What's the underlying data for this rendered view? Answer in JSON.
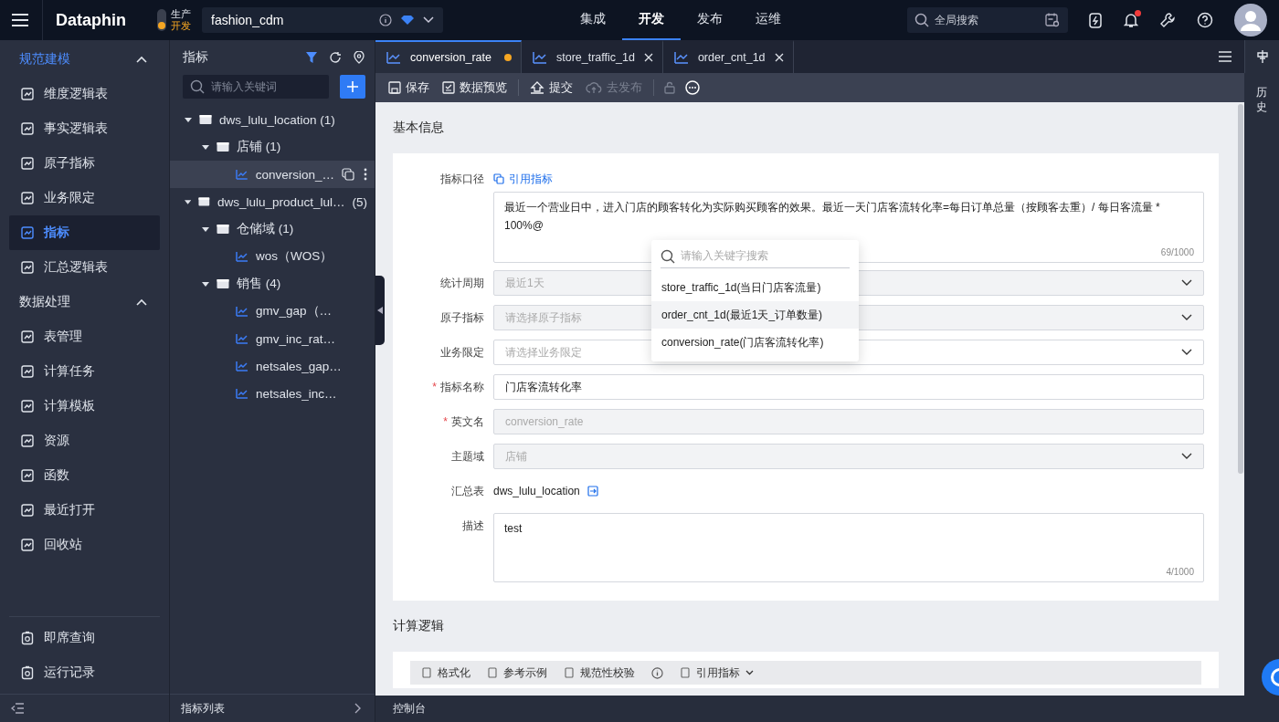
{
  "top_bar": {
    "logo": "Dataphin",
    "env": {
      "line1": "生产",
      "line2": "开发"
    },
    "project": "fashion_cdm",
    "nav": [
      {
        "label": "集成",
        "selected": false
      },
      {
        "label": "开发",
        "selected": true
      },
      {
        "label": "发布",
        "selected": false
      },
      {
        "label": "运维",
        "selected": false
      }
    ],
    "search": {
      "placeholder": "全局搜索"
    },
    "unread": true
  },
  "sidebar": {
    "sections": [
      {
        "title": "规范建模",
        "expanded": true,
        "items": [
          {
            "label": "维度逻辑表",
            "selected": false
          },
          {
            "label": "事实逻辑表",
            "selected": false
          },
          {
            "label": "原子指标",
            "selected": false
          },
          {
            "label": "业务限定",
            "selected": false
          },
          {
            "label": "指标",
            "selected": true
          },
          {
            "label": "汇总逻辑表",
            "selected": false
          }
        ]
      },
      {
        "title": "数据处理",
        "expanded": true,
        "items": [
          {
            "label": "表管理",
            "selected": false
          },
          {
            "label": "计算任务",
            "selected": false
          },
          {
            "label": "计算模板",
            "selected": false
          },
          {
            "label": "资源",
            "selected": false
          },
          {
            "label": "函数",
            "selected": false
          },
          {
            "label": "最近打开",
            "selected": false
          },
          {
            "label": "回收站",
            "selected": false
          }
        ]
      }
    ],
    "footer_items": [
      {
        "label": "即席查询"
      },
      {
        "label": "运行记录"
      }
    ]
  },
  "tree_panel": {
    "title": "指标",
    "search": {
      "placeholder": "请输入关键词"
    },
    "nodes": [
      {
        "kind": "table",
        "label": "dws_lulu_location (1)",
        "expanded": true,
        "children": [
          {
            "kind": "folder",
            "label": "店铺 (1)",
            "expanded": true,
            "children": [
              {
                "kind": "metric",
                "label": "conversion_…",
                "selected": true
              }
            ]
          }
        ]
      },
      {
        "kind": "table",
        "label": "dws_lulu_product_lul…",
        "count": "(5)",
        "expanded": true,
        "children": [
          {
            "kind": "folder",
            "label": "仓储域 (1)",
            "expanded": true,
            "children": [
              {
                "kind": "metric",
                "label": "wos（WOS）",
                "selected": false
              }
            ]
          },
          {
            "kind": "folder",
            "label": "销售 (4)",
            "expanded": true,
            "children": [
              {
                "kind": "metric",
                "label": "gmv_gap（…",
                "selected": false
              },
              {
                "kind": "metric",
                "label": "gmv_inc_rat…",
                "selected": false
              },
              {
                "kind": "metric",
                "label": "netsales_gap…",
                "selected": false
              },
              {
                "kind": "metric",
                "label": "netsales_inc…",
                "selected": false
              }
            ]
          }
        ]
      }
    ],
    "footer": "指标列表"
  },
  "tabs": [
    {
      "label": "conversion_rate",
      "selected": true,
      "modified": true
    },
    {
      "label": "store_traffic_1d",
      "selected": false,
      "modified": false
    },
    {
      "label": "order_cnt_1d",
      "selected": false,
      "modified": false
    }
  ],
  "toolbar": [
    {
      "kind": "save",
      "label": "保存",
      "disabled": false
    },
    {
      "kind": "preview",
      "label": "数据预览",
      "disabled": false
    },
    {
      "kind": "submit",
      "label": "提交",
      "disabled": false
    },
    {
      "kind": "publish",
      "label": "去发布",
      "disabled": true
    }
  ],
  "side_strip": {
    "label": "历史"
  },
  "basic_info": {
    "title": "基本信息",
    "fields": [
      {
        "kind": "textarea",
        "label": "指标口径",
        "action": "引用指标",
        "value": "最近一个营业日中，进入门店的顾客转化为实际购买顾客的效果。最近一天门店客流转化率=每日订单总量（按顾客去重）/ 每日客流量 * 100%@",
        "counter": "69/1000"
      },
      {
        "kind": "select",
        "label": "统计周期",
        "value": "最近1天",
        "disabled": true
      },
      {
        "kind": "select",
        "label": "原子指标",
        "placeholder": "请选择原子指标",
        "disabled": true
      },
      {
        "kind": "select",
        "label": "业务限定",
        "placeholder": "请选择业务限定",
        "disabled": false
      },
      {
        "kind": "input",
        "label": "指标名称",
        "required_mark": "*",
        "value": "门店客流转化率",
        "disabled": false
      },
      {
        "kind": "input",
        "label": "英文名",
        "required_mark": "*",
        "value": "conversion_rate",
        "disabled": true
      },
      {
        "kind": "select",
        "label": "主题域",
        "value": "店铺",
        "disabled": true
      },
      {
        "kind": "link",
        "label": "汇总表",
        "value": "dws_lulu_location"
      },
      {
        "kind": "textarea",
        "label": "描述",
        "value": "test",
        "counter": "4/1000"
      }
    ]
  },
  "dropdown": {
    "placeholder": "请输入关键字搜索",
    "options": [
      {
        "label": "store_traffic_1d(当日门店客流量)",
        "selected": false
      },
      {
        "label": "order_cnt_1d(最近1天_订单数量)",
        "selected": true
      },
      {
        "label": "conversion_rate(门店客流转化率)",
        "selected": false
      }
    ]
  },
  "logic": {
    "title": "计算逻辑",
    "tools": [
      {
        "kind": "format",
        "label": "格式化"
      },
      {
        "kind": "example",
        "label": "参考示例"
      },
      {
        "kind": "check",
        "label": "规范性校验"
      },
      {
        "kind": "info"
      },
      {
        "kind": "ref",
        "label": "引用指标"
      }
    ]
  },
  "console": "控制台"
}
